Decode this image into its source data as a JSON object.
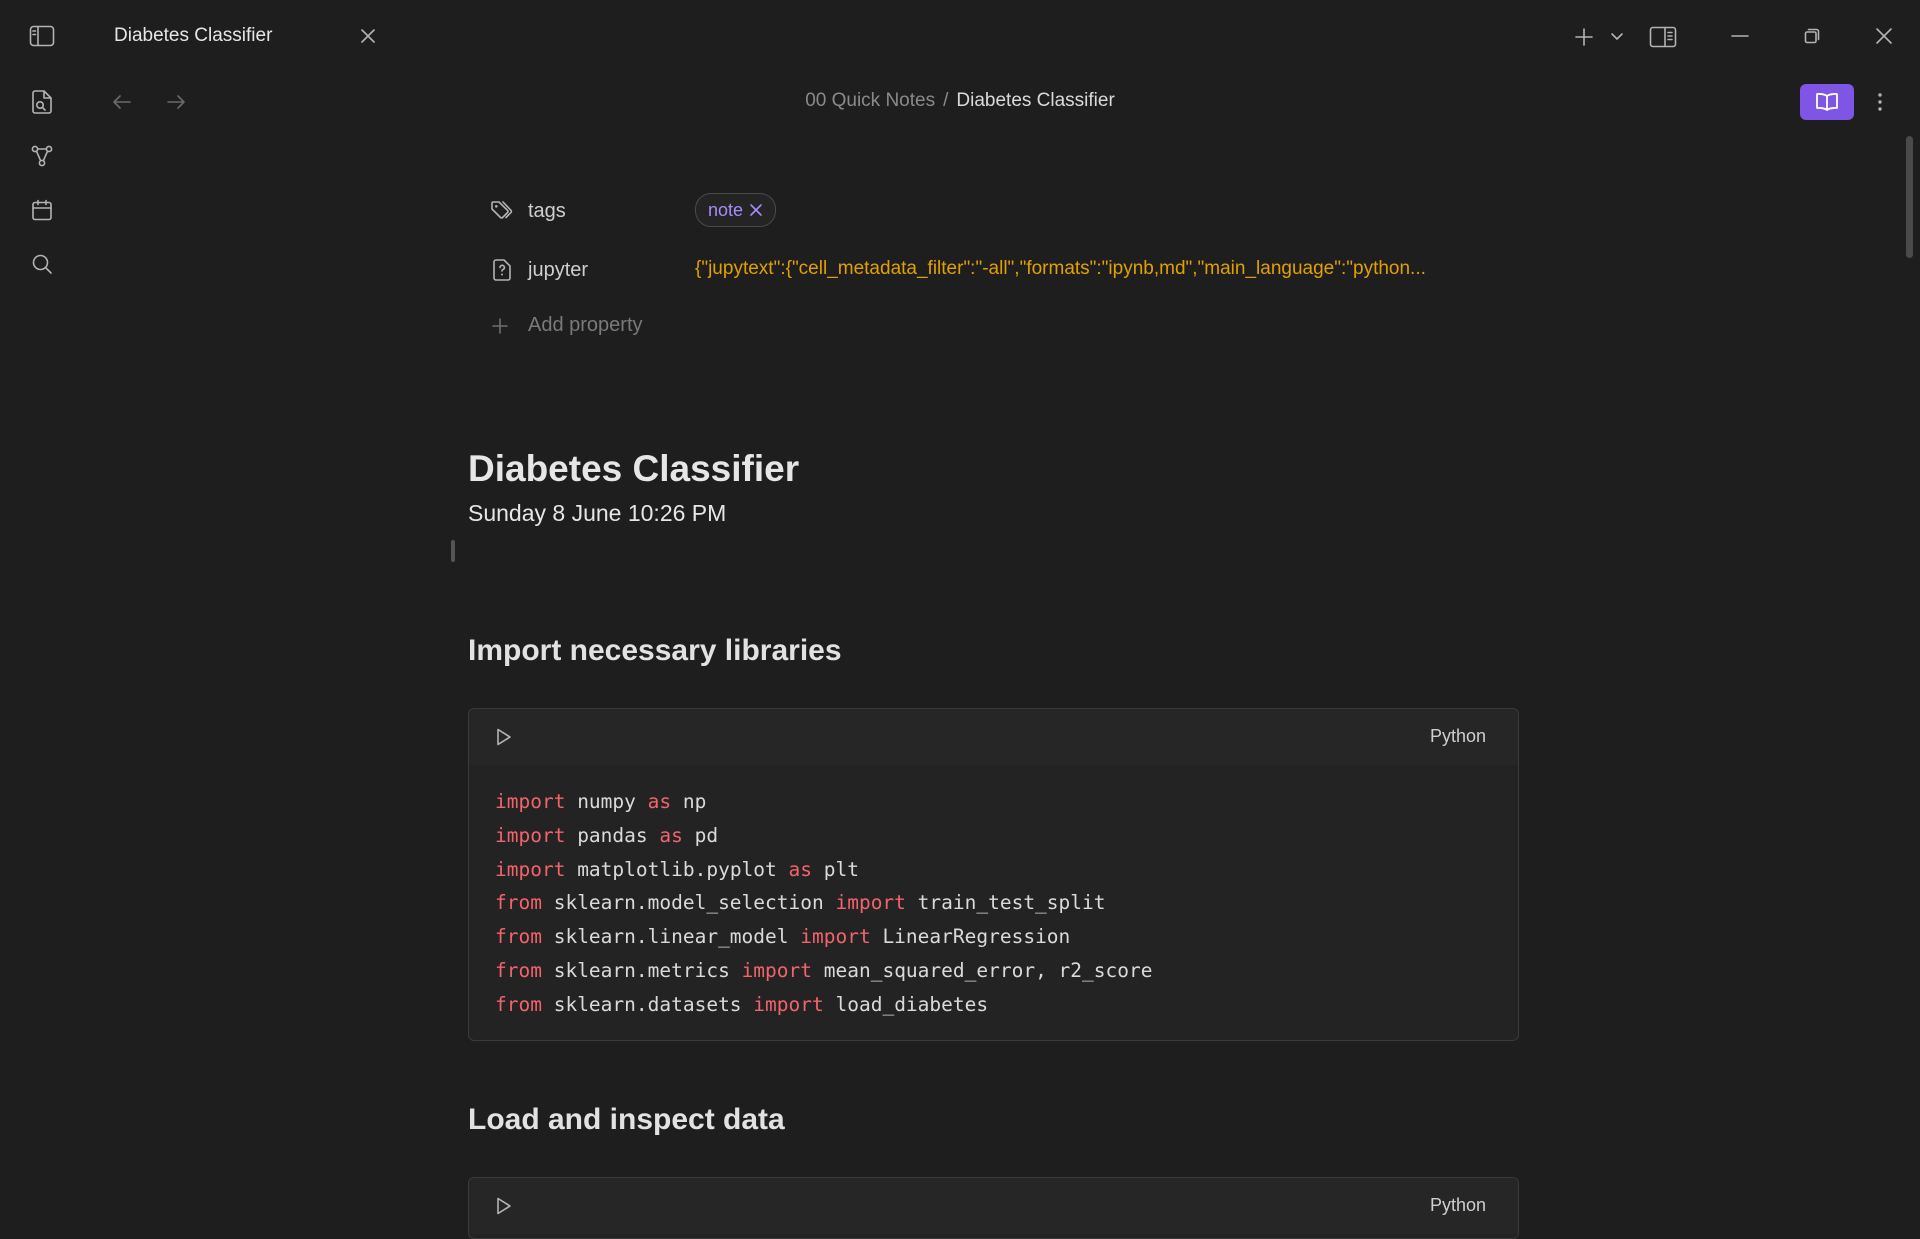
{
  "tab": {
    "title": "Diabetes Classifier"
  },
  "breadcrumb": {
    "parent": "00 Quick Notes",
    "separator": "/",
    "current": "Diabetes Classifier"
  },
  "properties": {
    "tags": {
      "key": "tags",
      "values": [
        "note"
      ]
    },
    "jupyter": {
      "key": "jupyter",
      "value": "{\"jupytext\":{\"cell_metadata_filter\":\"-all\",\"formats\":\"ipynb,md\",\"main_language\":\"python..."
    },
    "add_label": "Add property"
  },
  "document": {
    "title": "Diabetes Classifier",
    "date": "Sunday 8 June 10:26 PM",
    "sections": [
      {
        "heading": "Import necessary libraries",
        "code_language": "Python"
      },
      {
        "heading": "Load and inspect data",
        "code_language": "Python"
      }
    ]
  },
  "code_lines": [
    [
      [
        "kw",
        "import"
      ],
      [
        "t",
        " numpy "
      ],
      [
        "kw",
        "as"
      ],
      [
        "t",
        " np"
      ]
    ],
    [
      [
        "kw",
        "import"
      ],
      [
        "t",
        " pandas "
      ],
      [
        "kw",
        "as"
      ],
      [
        "t",
        " pd"
      ]
    ],
    [
      [
        "kw",
        "import"
      ],
      [
        "t",
        " matplotlib.pyplot "
      ],
      [
        "kw",
        "as"
      ],
      [
        "t",
        " plt"
      ]
    ],
    [
      [
        "kw",
        "from"
      ],
      [
        "t",
        " sklearn.model_selection "
      ],
      [
        "kw",
        "import"
      ],
      [
        "t",
        " train_test_split"
      ]
    ],
    [
      [
        "kw",
        "from"
      ],
      [
        "t",
        " sklearn.linear_model "
      ],
      [
        "kw",
        "import"
      ],
      [
        "t",
        " LinearRegression"
      ]
    ],
    [
      [
        "kw",
        "from"
      ],
      [
        "t",
        " sklearn.metrics "
      ],
      [
        "kw",
        "import"
      ],
      [
        "t",
        " mean_squared_error, r2_score"
      ]
    ],
    [
      [
        "kw",
        "from"
      ],
      [
        "t",
        " sklearn.datasets "
      ],
      [
        "kw",
        "import"
      ],
      [
        "t",
        " load_diabetes"
      ]
    ]
  ],
  "colors": {
    "accent": "#7f55e5",
    "keyword": "#f2636b",
    "property_value": "#e0a000",
    "tag": "#a88bfa",
    "background": "#1e1e1e"
  },
  "icons": {
    "ribbon": [
      "sidebar-toggle-icon",
      "file-search-icon",
      "graph-icon",
      "calendar-icon",
      "search-icon"
    ],
    "titlebar": [
      "plus-icon",
      "chevron-down-icon",
      "split-pane-icon",
      "minimize-icon",
      "restore-icon",
      "close-icon"
    ]
  }
}
